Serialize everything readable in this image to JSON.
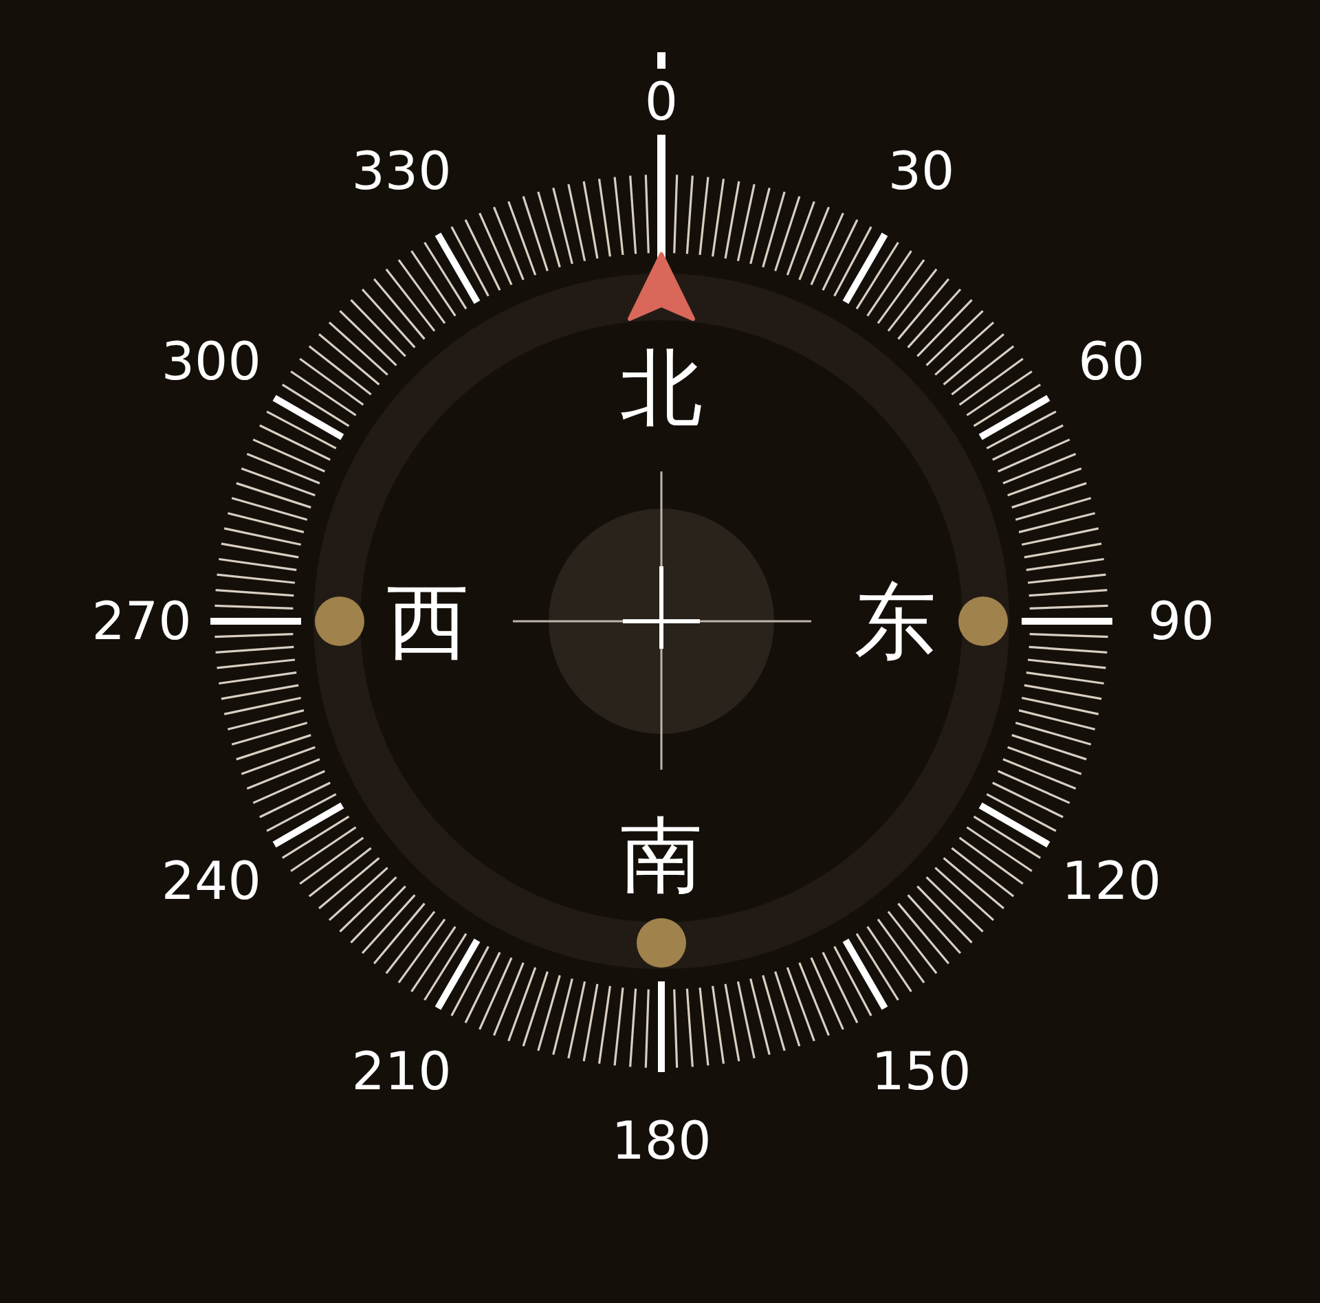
{
  "dial": {
    "degree_labels": [
      "0",
      "30",
      "60",
      "90",
      "120",
      "150",
      "180",
      "210",
      "240",
      "270",
      "300",
      "330"
    ]
  },
  "cardinals": [
    "北",
    "东",
    "南",
    "西"
  ]
}
